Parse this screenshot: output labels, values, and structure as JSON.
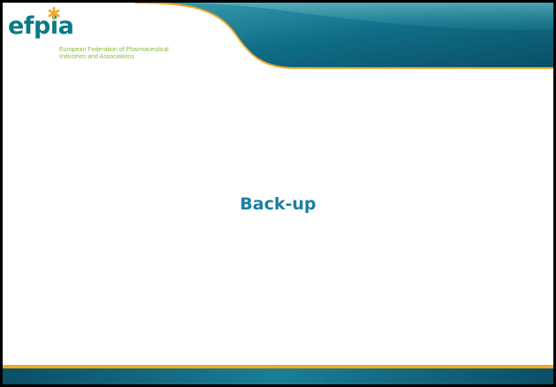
{
  "slide": {
    "title": "Back-up"
  },
  "logo": {
    "wordmark": "efpia",
    "tagline_line1": "European Federation of Pharmaceutical",
    "tagline_line2": "Industries and Associations"
  },
  "colors": {
    "header_teal": "#0f6e87",
    "header_teal_light": "#2d93a6",
    "accent_orange": "#f5a623",
    "logo_teal": "#0a7a86",
    "logo_green": "#8dbd3a",
    "title_blue": "#1b7fa0"
  }
}
